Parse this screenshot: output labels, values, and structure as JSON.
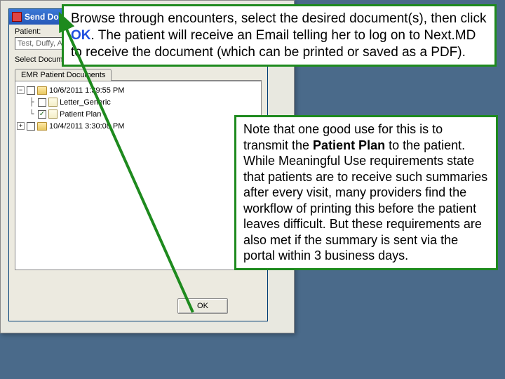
{
  "window": {
    "title": "Send Docum",
    "patient_label": "Patient:",
    "patient_value": "Test, Duffy, A...",
    "select_label": "Select Documents:",
    "tab_label": "EMR Patient Documents"
  },
  "tree": {
    "n0_label": "10/6/2011 1:39:55 PM",
    "n0_exp": "−",
    "n1_label": "Letter_Generic",
    "n2_label": "Patient Plan",
    "n2_check": "✓",
    "n3_label": "10/4/2011 3:30:08 PM",
    "n3_exp": "+"
  },
  "buttons": {
    "ok": "OK"
  },
  "callout1": {
    "p1a": "Browse through encounters, select the desired document(s), then click ",
    "ok": "OK",
    "p1b": ".  The patient will receive an Email telling her to log on to Next.MD to receive the document (which can be printed or saved as a PDF)."
  },
  "callout2": {
    "p1a": "Note that one good use for this is to transmit the ",
    "bold": "Patient Plan",
    "p1b": " to the patient.  While Meaningful Use requirements state that patients are to receive such summaries after every visit, many providers find the workflow of printing this before the patient leaves difficult. But these requirements are also met if the summary is sent via the portal within 3 business days."
  }
}
